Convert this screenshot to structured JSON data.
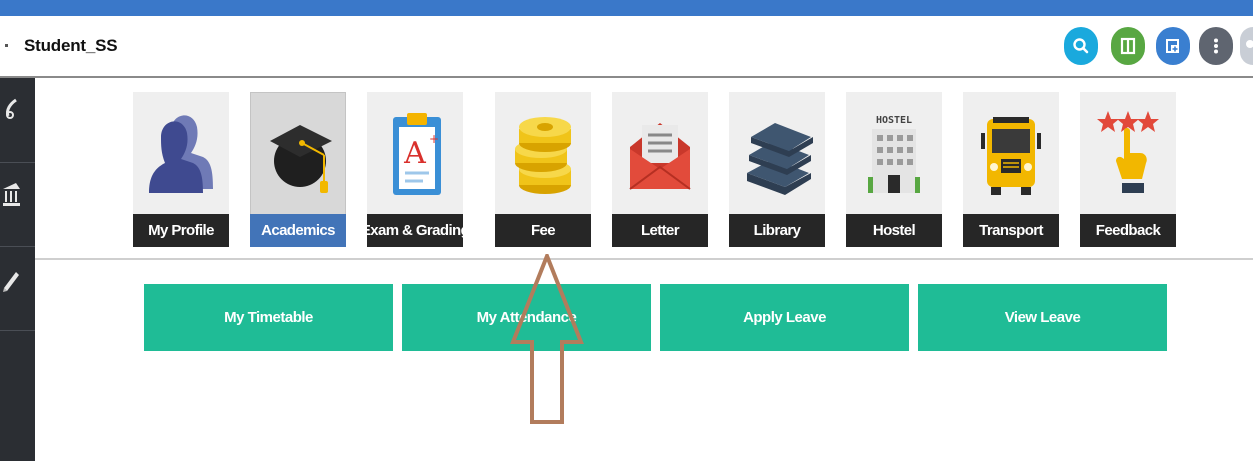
{
  "header": {
    "title": "Student_SS",
    "actions": [
      {
        "icon": "search-icon",
        "color": "#1aa9dd"
      },
      {
        "icon": "columns-icon",
        "color": "#58a742"
      },
      {
        "icon": "notebook-icon",
        "color": "#3a7fd0"
      },
      {
        "icon": "more-vertical-icon",
        "color": "#5f6570"
      },
      {
        "icon": "avatar-icon",
        "color": "#c9ced6"
      }
    ]
  },
  "sidebar": {
    "icons": [
      "pen-icon",
      "institution-icon",
      "pencil-icon"
    ]
  },
  "modules": [
    {
      "label": "My Profile",
      "icon": "profile-icon",
      "active": false
    },
    {
      "label": "Academics",
      "icon": "graduation-cap-icon",
      "active": true
    },
    {
      "label": "Exam & Grading",
      "icon": "exam-clipboard-icon",
      "active": false
    },
    {
      "label": "Fee",
      "icon": "coins-icon",
      "active": false
    },
    {
      "label": "Letter",
      "icon": "envelope-icon",
      "active": false
    },
    {
      "label": "Library",
      "icon": "books-icon",
      "active": false
    },
    {
      "label": "Hostel",
      "icon": "hostel-building-icon",
      "badge": "HOSTEL",
      "active": false
    },
    {
      "label": "Transport",
      "icon": "school-bus-icon",
      "active": false
    },
    {
      "label": "Feedback",
      "icon": "feedback-stars-icon",
      "active": false
    }
  ],
  "quick_actions": [
    {
      "label": "My Timetable"
    },
    {
      "label": "My Attendance"
    },
    {
      "label": "Apply Leave"
    },
    {
      "label": "View Leave"
    }
  ],
  "colors": {
    "topbar": "#3a78c9",
    "sidebar": "#2b2e33",
    "active_tab": "#4274b8",
    "quick_action": "#1fbc96",
    "annotation_arrow": "#b27c5c"
  }
}
